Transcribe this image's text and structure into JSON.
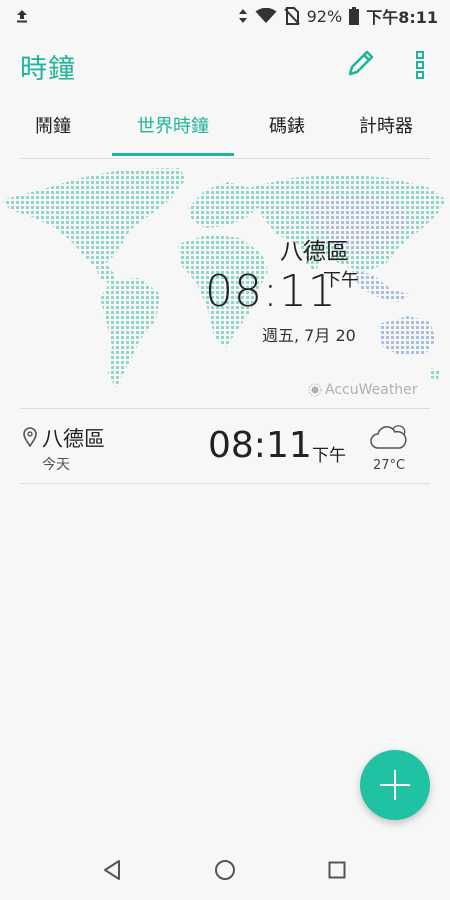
{
  "status_bar": {
    "battery": "92%",
    "time": "下午8:11"
  },
  "app_bar": {
    "title": "時鐘"
  },
  "tabs": [
    {
      "label": "鬧鐘",
      "active": false
    },
    {
      "label": "世界時鐘",
      "active": true
    },
    {
      "label": "碼錶",
      "active": false
    },
    {
      "label": "計時器",
      "active": false
    }
  ],
  "map": {
    "city": "八德區",
    "time": "08:11",
    "ampm": "下午",
    "date": "週五, 7月 20",
    "provider": "AccuWeather"
  },
  "city_list": [
    {
      "city": "八德區",
      "day": "今天",
      "time": "08:11",
      "ampm": "下午",
      "temperature": "27°C",
      "weather_icon": "cloud-icon"
    }
  ],
  "colors": {
    "accent": "#1fb59b",
    "fab": "#21c2a4",
    "map_dots": "#8fd8c8",
    "map_dots_asia": "#9bb8dd"
  }
}
